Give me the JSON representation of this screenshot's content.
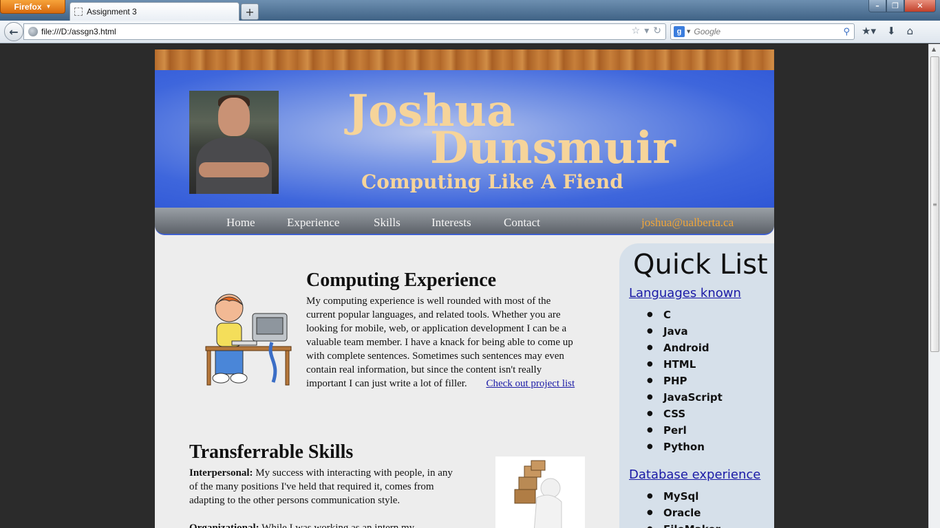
{
  "browser": {
    "menu_button": "Firefox",
    "tab_title": "Assignment 3",
    "new_tab": "+",
    "url": "file:///D:/assgn3.html",
    "search_placeholder": "Google",
    "search_engine_icon": "g-icon"
  },
  "header": {
    "first_name": "Joshua",
    "last_name": "Dunsmuir",
    "tagline": "Computing Like A Fiend"
  },
  "nav": {
    "items": [
      "Home",
      "Experience",
      "Skills",
      "Interests",
      "Contact"
    ],
    "email": "joshua@ualberta.ca"
  },
  "experience": {
    "heading": "Computing Experience",
    "body": "My computing experience is well rounded with most of the current popular languages, and related tools. Whether you are looking for mobile, web, or application development I can be a valuable team member. I have a knack for being able to come up with complete sentences. Sometimes such sentences may even contain real information, but since the content isn't really important I can just write a lot of filler.",
    "link": "Check out project list"
  },
  "skills": {
    "heading": "Transferrable Skills",
    "interpersonal_label": "Interpersonal:",
    "interpersonal_text": "My success with interacting with people, in any of the many positions I've held that required it, comes from adapting to the other persons communication style.",
    "organizational_label": "Organizational:",
    "organizational_text": "While I was working as an intern my"
  },
  "sidebar": {
    "title": "Quick List",
    "languages_link": "Languages known",
    "languages": [
      "C",
      "Java",
      "Android",
      "HTML",
      "PHP",
      "JavaScript",
      "CSS",
      "Perl",
      "Python"
    ],
    "database_link": "Database experience",
    "databases": [
      "MySql",
      "Oracle",
      "FileMaker"
    ]
  }
}
